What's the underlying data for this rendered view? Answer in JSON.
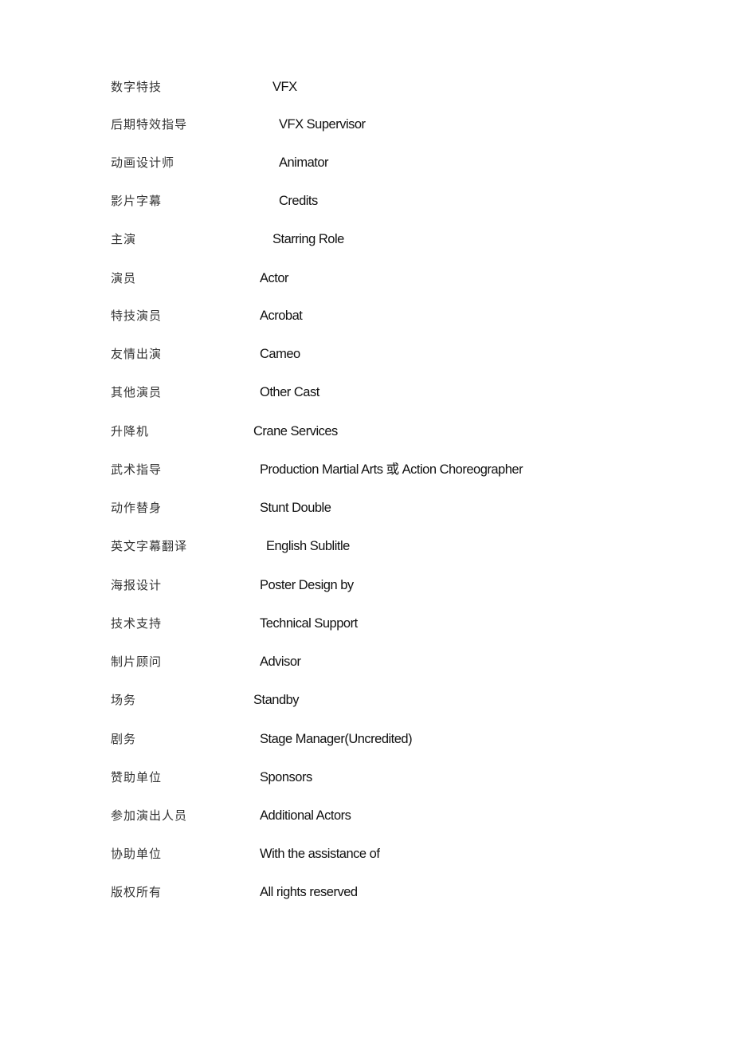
{
  "document": {
    "title": "",
    "glossary": [
      {
        "zh": "数字特技",
        "en": "VFX"
      },
      {
        "zh": "后期特效指导",
        "en": "VFX Supervisor"
      },
      {
        "zh": "动画设计师",
        "en": "Animator"
      },
      {
        "zh": "影片字幕",
        "en": "Credits"
      },
      {
        "zh": "主演",
        "en": "Starring Role"
      },
      {
        "zh": "演员",
        "en": "Actor"
      },
      {
        "zh": "特技演员",
        "en": "Acrobat"
      },
      {
        "zh": "友情出演",
        "en": "Cameo"
      },
      {
        "zh": "其他演员",
        "en": "Other Cast"
      },
      {
        "zh": "升降机",
        "en": "Crane Services"
      },
      {
        "zh": "武术指导",
        "en": "Production Martial Arts 或 Action Choreographer"
      },
      {
        "zh": "动作替身",
        "en": "Stunt Double"
      },
      {
        "zh": "英文字幕翻译",
        "en": "English Sublitle"
      },
      {
        "zh": "海报设计",
        "en": "Poster Design by"
      },
      {
        "zh": "技术支持",
        "en": "Technical Support"
      },
      {
        "zh": "制片顾问",
        "en": "Advisor"
      },
      {
        "zh": "场务",
        "en": "Standby"
      },
      {
        "zh": "剧务",
        "en": "Stage Manager(Uncredited)"
      },
      {
        "zh": "赞助单位",
        "en": "Sponsors"
      },
      {
        "zh": "参加演出人员",
        "en": "Additional Actors"
      },
      {
        "zh": "协助单位",
        "en": "With the assistance of"
      },
      {
        "zh": "版权所有",
        "en": "All rights reserved"
      }
    ]
  }
}
